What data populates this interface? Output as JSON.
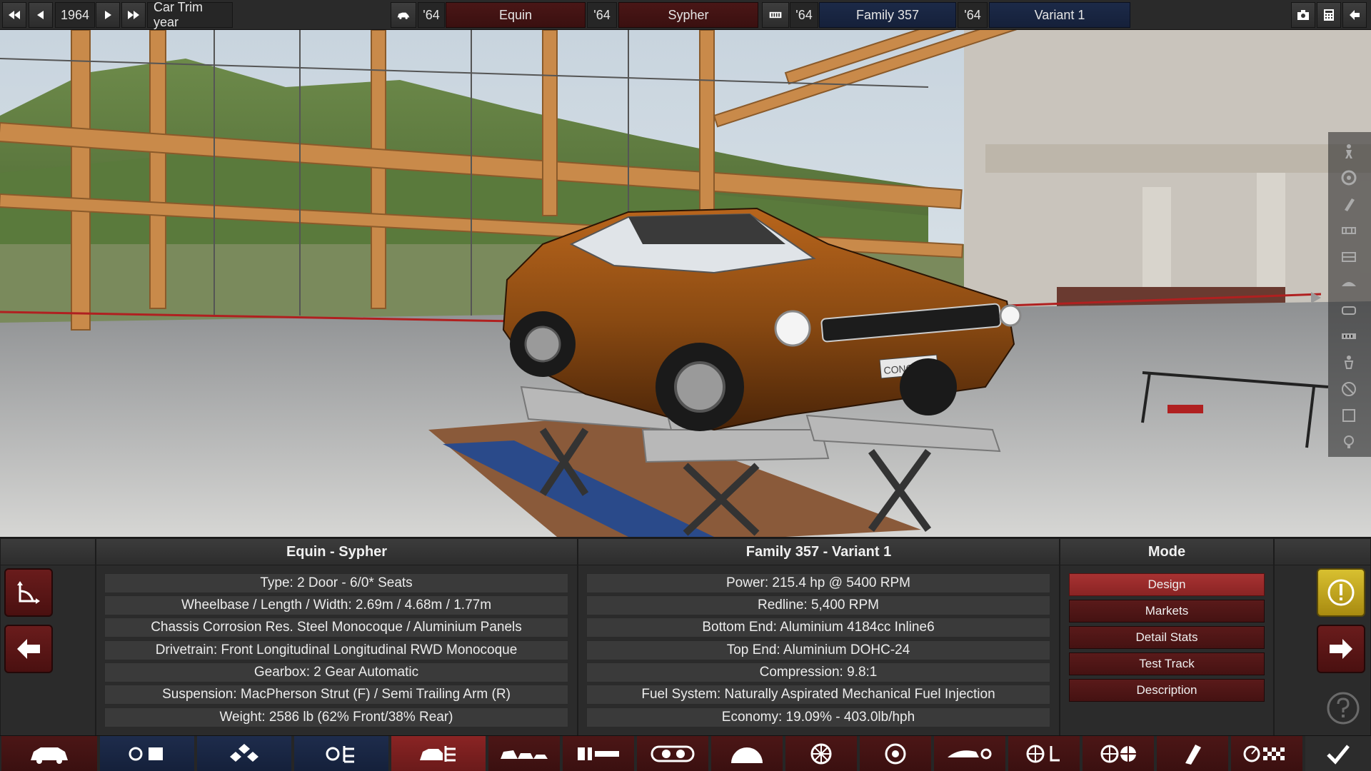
{
  "topbar": {
    "year": "1964",
    "year_caption": "Car Trim year",
    "model_year": "'64",
    "model_name": "Equin",
    "trim_year": "'64",
    "trim_name": "Sypher",
    "family_year": "'64",
    "family_name": "Family 357",
    "variant_year": "'64",
    "variant_name": "Variant 1"
  },
  "scene": {
    "plate_text": "CONCEPT",
    "car_color": "#8a4a12"
  },
  "car_panel": {
    "title": "Equin - Sypher",
    "rows": [
      "Type: 2 Door - 6/0* Seats",
      "Wheelbase / Length / Width: 2.69m / 4.68m / 1.77m",
      "Chassis Corrosion Res. Steel Monocoque / Aluminium Panels",
      "Drivetrain: Front Longitudinal Longitudinal RWD Monocoque",
      "Gearbox: 2 Gear Automatic",
      "Suspension: MacPherson Strut (F) / Semi Trailing Arm (R)",
      "Weight: 2586 lb (62% Front/38% Rear)"
    ]
  },
  "engine_panel": {
    "title": "Family 357 - Variant 1",
    "rows": [
      "Power: 215.4 hp @ 5400 RPM",
      "Redline:  5,400 RPM",
      "Bottom End: Aluminium 4184cc Inline6",
      "Top End: Aluminium DOHC-24",
      "Compression: 9.8:1",
      "Fuel System: Naturally Aspirated Mechanical Fuel Injection",
      "Economy: 19.09% - 403.0lb/hph"
    ]
  },
  "mode_panel": {
    "title": "Mode",
    "buttons": [
      "Design",
      "Markets",
      "Detail Stats",
      "Test Track",
      "Description"
    ],
    "active": "Design"
  },
  "colors": {
    "accent_red": "#a83232",
    "accent_blue": "#1c2a48",
    "warning_yellow": "#d8c030"
  },
  "icons": {
    "sidebar": [
      "driver-icon",
      "wheel-icon",
      "paint-icon",
      "grille-icon",
      "panel-icon",
      "roof-icon",
      "interior-icon",
      "trim-icon",
      "seat-icon",
      "steering-icon",
      "frame-icon",
      "light-icon"
    ],
    "bottom_nav": [
      "car-icon",
      "engine-family-icon",
      "engine-icon",
      "engine-tune-icon",
      "car-trim-icon",
      "body-icon",
      "chassis-icon",
      "headlight-icon",
      "suspension-icon",
      "brake-icon",
      "tyre-icon",
      "aero-icon",
      "steering-icon",
      "wheel-icon",
      "paint-icon",
      "test-icon",
      "finish-icon"
    ]
  }
}
